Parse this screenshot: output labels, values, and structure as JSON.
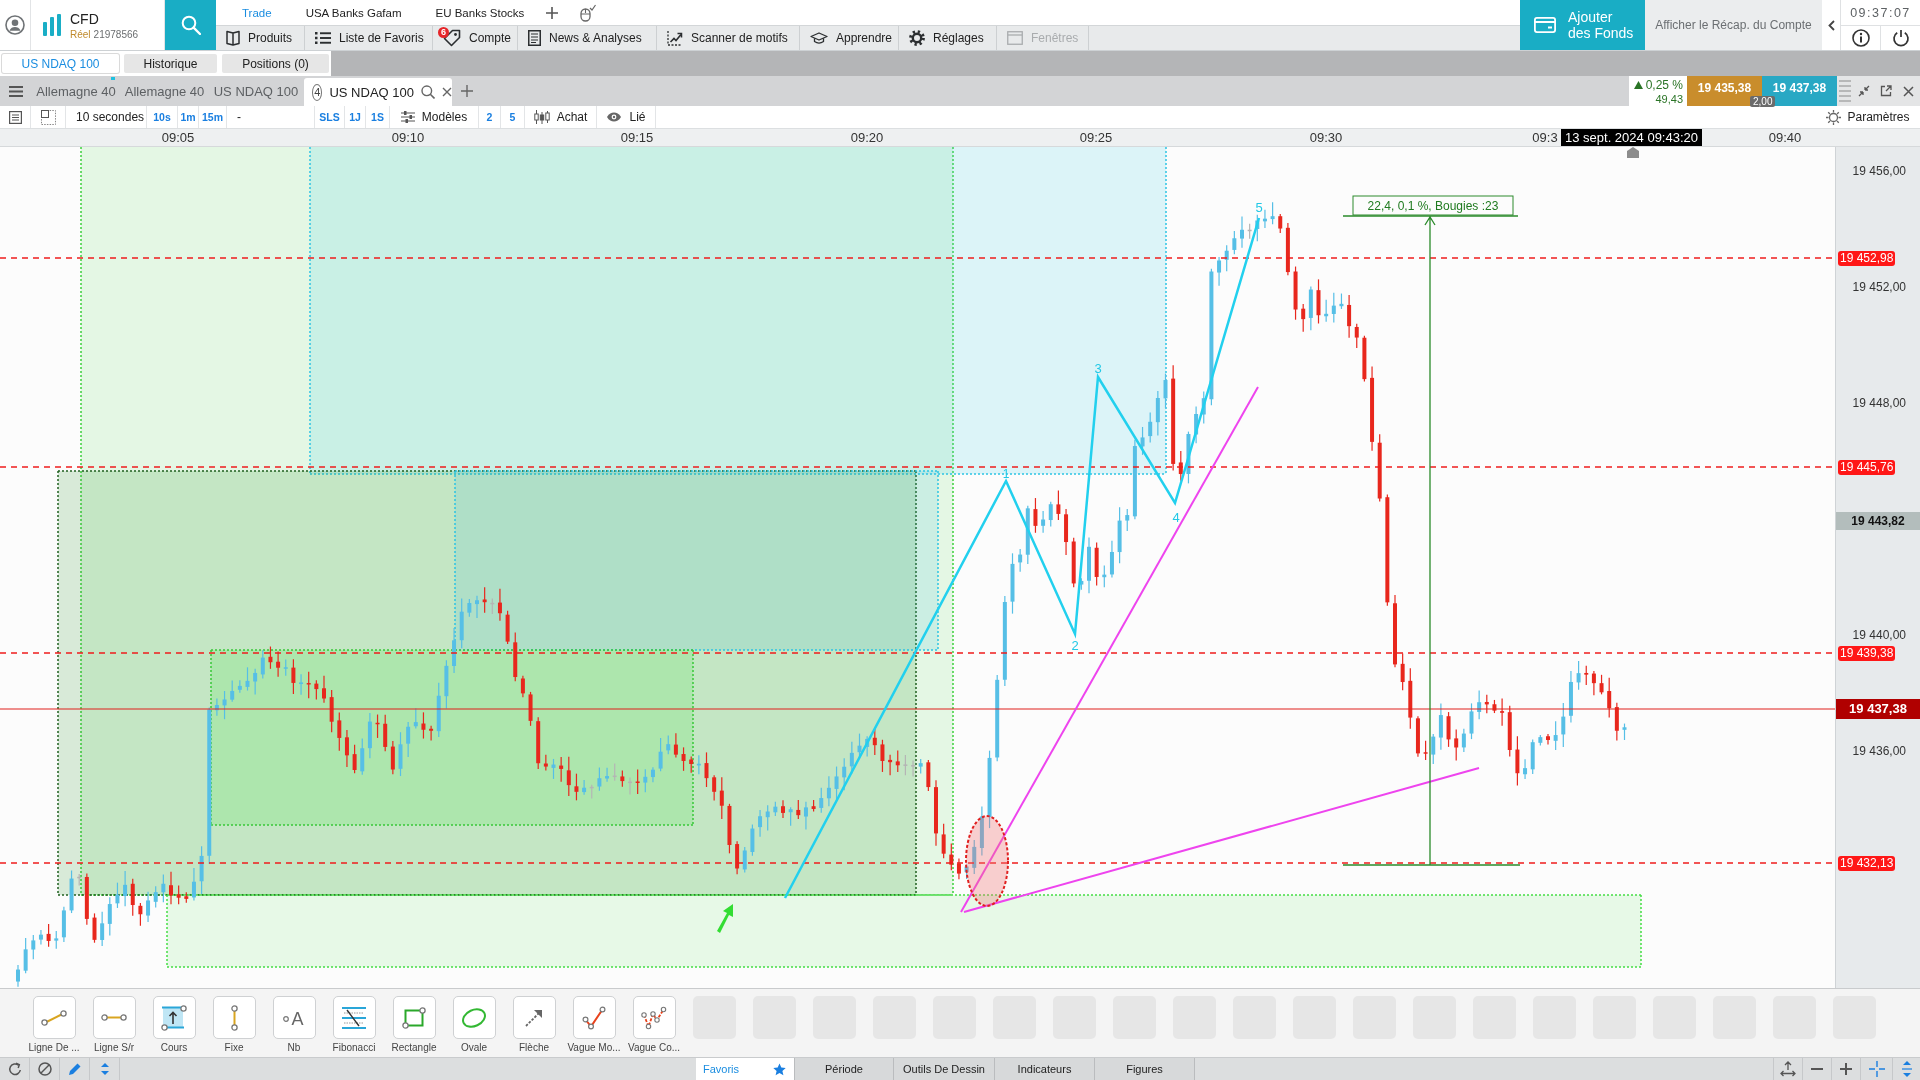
{
  "header": {
    "account": {
      "type": "CFD",
      "mode": "Réel",
      "number": "21978566"
    },
    "top_links": [
      {
        "label": "Trade",
        "selected": true
      },
      {
        "label": "USA Banks Gafam",
        "selected": false
      },
      {
        "label": "EU Banks Stocks",
        "selected": false
      }
    ],
    "menu": [
      {
        "label": "Produits",
        "disabled": false
      },
      {
        "label": "Liste de Favoris",
        "disabled": false
      },
      {
        "label": "Compte",
        "disabled": false,
        "badge": "6"
      },
      {
        "label": "News & Analyses",
        "disabled": false
      },
      {
        "label": "Scanner de motifs",
        "disabled": false
      },
      {
        "label": "Apprendre",
        "disabled": false
      },
      {
        "label": "Réglages",
        "disabled": false
      },
      {
        "label": "Fenêtres",
        "disabled": true
      }
    ],
    "add_funds": "Ajouter des Fonds",
    "account_summary": "Afficher le Récap. du Compte",
    "clock": "09:37:07"
  },
  "sub_tabs": [
    {
      "label": "US NDAQ 100",
      "selected": true
    },
    {
      "label": "Historique",
      "selected": false
    },
    {
      "label": "Positions (0)",
      "selected": false
    }
  ],
  "chart_tabs": [
    {
      "label": "Allemagne 40",
      "selected": false,
      "flagged": true
    },
    {
      "label": "Allemagne 40",
      "selected": false,
      "flagged": false
    },
    {
      "label": "US NDAQ 100",
      "selected": false,
      "flagged": false
    },
    {
      "label": "US NDAQ 100",
      "selected": true,
      "flagged": false,
      "number": "4"
    }
  ],
  "quote": {
    "rising": true,
    "change_percent": "0,25 %",
    "change": "49,43",
    "sell": "19 435,38",
    "buy": "19 437,38",
    "spread": "2,00"
  },
  "toolbar": {
    "interval": "10 secondes",
    "intervals": [
      "10s",
      "1m",
      "15m"
    ],
    "style": "-",
    "ranges": [
      "SLS",
      "1J",
      "1S"
    ],
    "templates": "Modèles",
    "template_slots": [
      "2",
      "5"
    ],
    "order": "Achat",
    "link": "Lié",
    "settings": "Paramètres"
  },
  "time_axis": {
    "ticks": [
      "09:05",
      "09:10",
      "09:15",
      "09:20",
      "09:25",
      "09:30",
      "09:3",
      "09:40"
    ],
    "cursor_time": "13 sept. 2024 09:43:20"
  },
  "chart": {
    "wave_labels": [
      "1",
      "2",
      "3",
      "4",
      "5"
    ],
    "measure_label": "22,4, 0,1 %, Bougies :23"
  },
  "price_axis": {
    "ticks": [
      "19 456,00",
      "19 452,00",
      "19 448,00",
      "19 440,00",
      "19 436,00"
    ],
    "markers": [
      {
        "label": "19 452,98",
        "kind": "alert"
      },
      {
        "label": "19 445,76",
        "kind": "alert"
      },
      {
        "label": "19 443,82",
        "kind": "cursor"
      },
      {
        "label": "19 439,38",
        "kind": "alert"
      },
      {
        "label": "19 437,38",
        "kind": "last"
      },
      {
        "label": "19 432,13",
        "kind": "alert"
      }
    ]
  },
  "drawing_tools": [
    {
      "label": "Ligne De ..."
    },
    {
      "label": "Ligne S/r"
    },
    {
      "label": "Cours"
    },
    {
      "label": "Fixe"
    },
    {
      "label": "Nb",
      "glyph": "A"
    },
    {
      "label": "Fibonacci"
    },
    {
      "label": "Rectangle"
    },
    {
      "label": "Ovale"
    },
    {
      "label": "Flèche"
    },
    {
      "label": "Vague Mo..."
    },
    {
      "label": "Vague Co..."
    }
  ],
  "bottom_tabs": [
    {
      "label": "Favoris",
      "selected": true
    },
    {
      "label": "Période",
      "selected": false
    },
    {
      "label": "Outils De Dessin",
      "selected": false
    },
    {
      "label": "Indicateurs",
      "selected": false
    },
    {
      "label": "Figures",
      "selected": false
    }
  ]
}
